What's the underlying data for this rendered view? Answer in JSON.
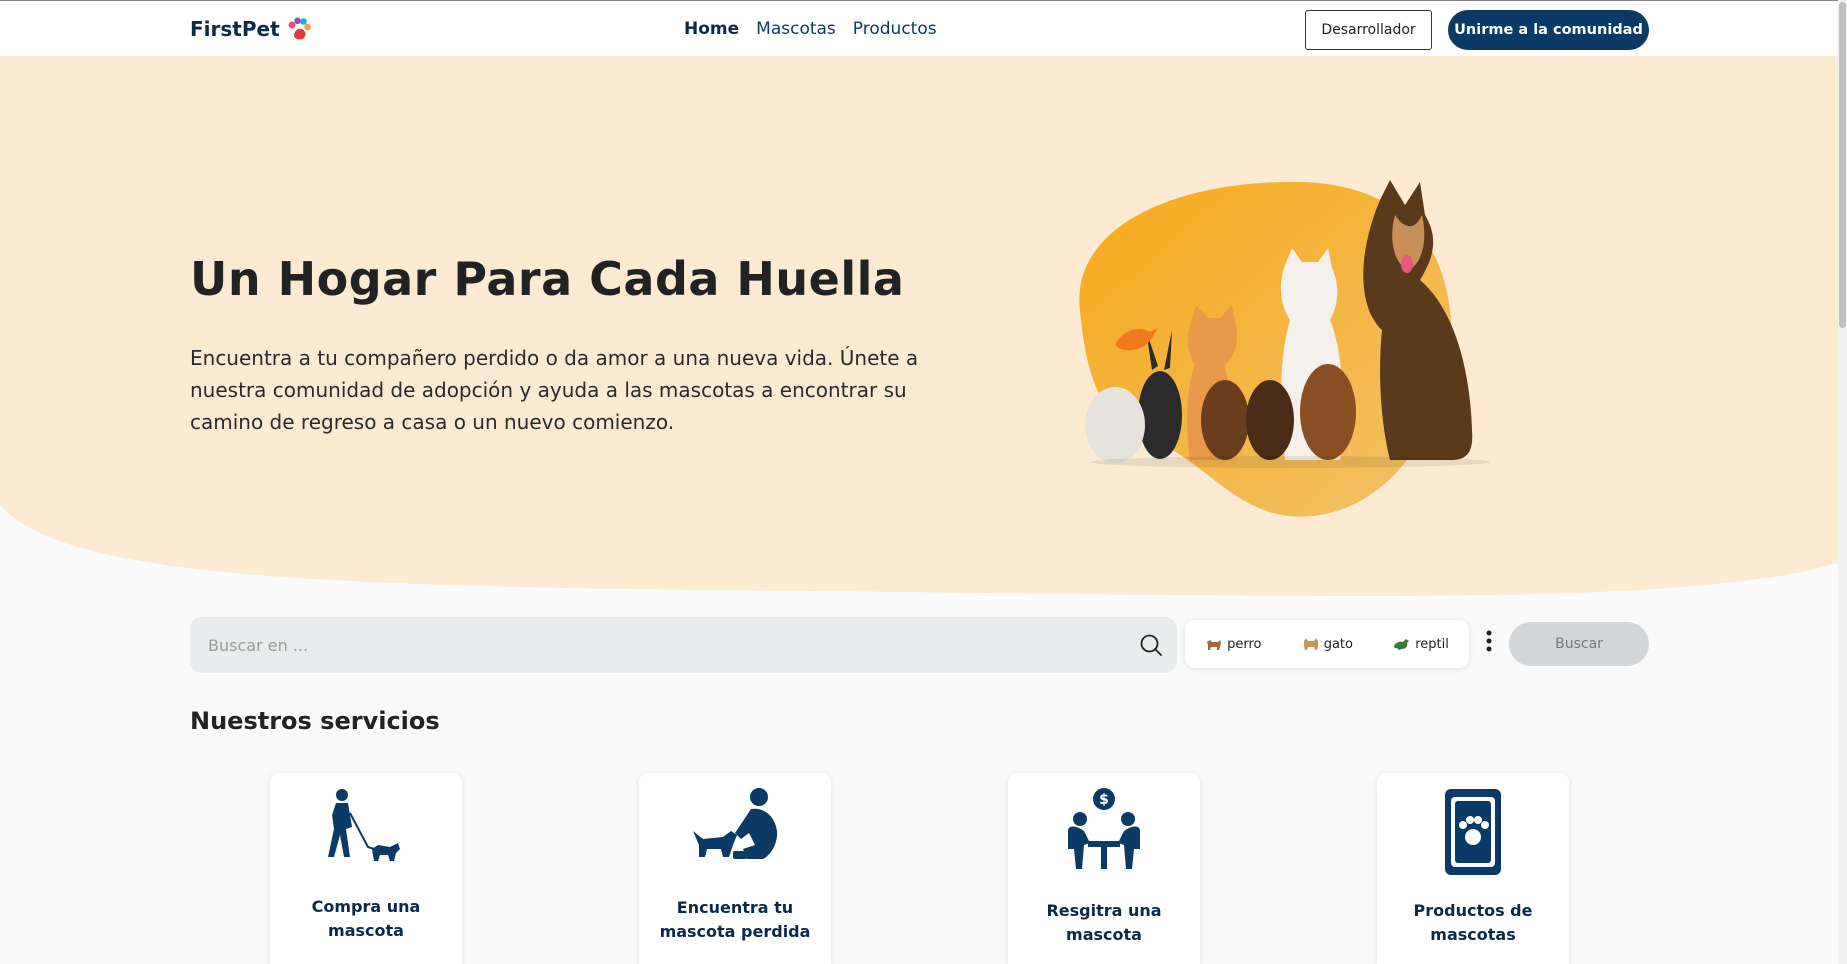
{
  "brand": {
    "name": "FirstPet",
    "logo_icon": "paw-icon"
  },
  "nav": {
    "items": [
      {
        "label": "Home",
        "active": true
      },
      {
        "label": "Mascotas",
        "active": false
      },
      {
        "label": "Productos",
        "active": false
      }
    ]
  },
  "header": {
    "developer_label": "Desarrollador",
    "join_label": "Unirme a la comunidad"
  },
  "hero": {
    "title": "Un Hogar Para Cada Huella",
    "text": "Encuentra a tu compañero perdido o da amor a una nueva vida. Únete a nuestra comunidad de adopción y ayuda a las mascotas a encontrar su camino de regreso a casa o un nuevo comienzo.",
    "image_icon": "pets-group-illustration"
  },
  "search": {
    "placeholder": "Buscar en ...",
    "filters": [
      {
        "label": "perro",
        "icon": "dog-icon"
      },
      {
        "label": "gato",
        "icon": "cat-icon"
      },
      {
        "label": "reptil",
        "icon": "reptile-icon"
      }
    ],
    "submit_label": "Buscar"
  },
  "services": {
    "title": "Nuestros servicios",
    "items": [
      {
        "label": "Compra una mascota",
        "icon": "person-walking-dog-icon"
      },
      {
        "label": "Encuentra tu mascota perdida",
        "icon": "person-feeding-dog-icon"
      },
      {
        "label": "Resgitra una mascota",
        "icon": "adoption-meeting-icon"
      },
      {
        "label": "Productos de mascotas",
        "icon": "pet-food-bag-icon"
      }
    ]
  },
  "colors": {
    "primary": "#0b3a66",
    "hero_bg": "#fcebd2",
    "accent": "#f5b13f"
  }
}
